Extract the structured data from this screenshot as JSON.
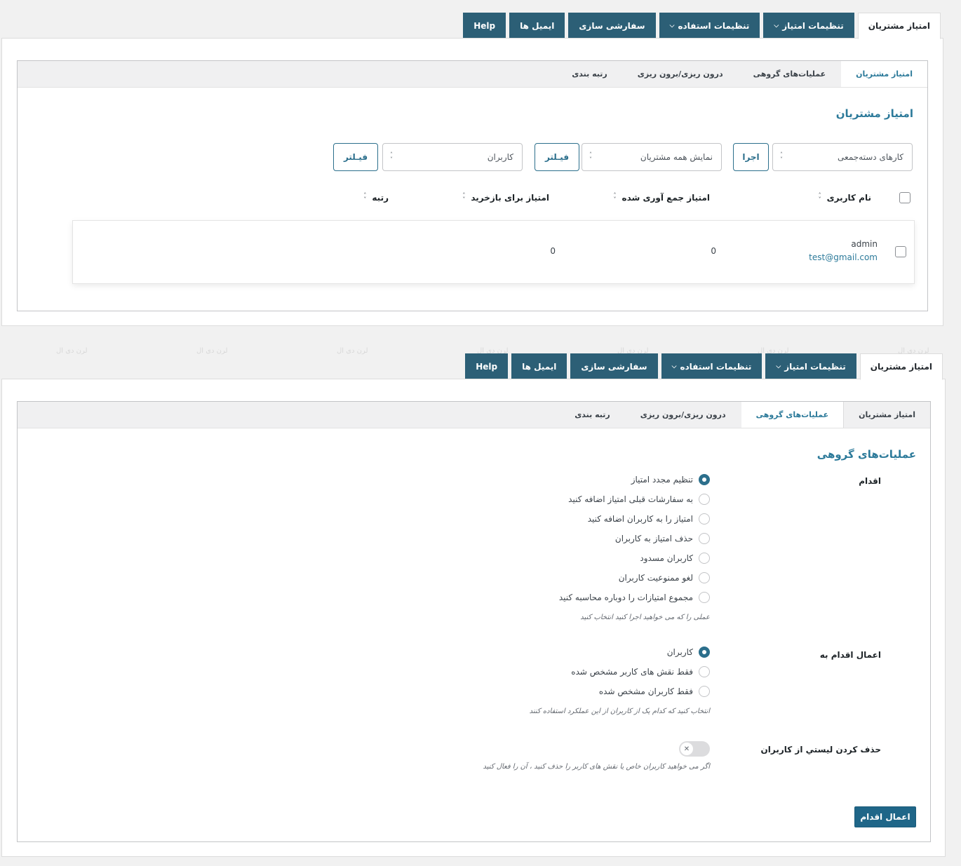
{
  "nav": {
    "tabs": [
      {
        "label": "امتیاز مشتریان",
        "active": true
      },
      {
        "label": "تنظیمات امتیاز",
        "dropdown": true
      },
      {
        "label": "تنظیمات استفاده",
        "dropdown": true
      },
      {
        "label": "سفارشی سازی"
      },
      {
        "label": "ایمیل ها"
      },
      {
        "label": "Help"
      }
    ]
  },
  "subtabs": [
    {
      "label": "امتیاز مشتریان"
    },
    {
      "label": "عملیات‌های گروهی"
    },
    {
      "label": "درون ریزی/برون ریزی"
    },
    {
      "label": "رتبه بندی"
    }
  ],
  "watermark": "لرن دی ال",
  "customers": {
    "title": "امتیاز مشتریان",
    "bulk_select": "کارهای دسته‌جمعی",
    "apply_button": "اجرا",
    "show_select": "نمایش همه مشتریان",
    "filter_button_1": "فیـلتر",
    "users_select": "کاربران",
    "filter_button_2": "فیـلتر",
    "columns": {
      "username": "نام کاربری",
      "collected": "امتیاز جمع آوری شده",
      "redeem": "امتیاز برای بازخرید",
      "rank": "رتبه"
    },
    "rows": [
      {
        "username": "admin",
        "email": "test@gmail.com",
        "collected": "0",
        "redeem": "0",
        "rank": ""
      }
    ]
  },
  "bulk": {
    "title": "عملیات‌های گروهی",
    "action_label": "اقدام",
    "actions": [
      "تنظیم مجدد امتیاز",
      "به سفارشات قبلی امتیاز اضافه کنید",
      "امتیاز را به کاربران اضافه کنید",
      "حذف امتیاز به کاربران",
      "کاربران مسدود",
      "لغو ممنوعیت کاربران",
      "مجموع امتیازات را دوباره محاسبه کنید"
    ],
    "action_selected_index": 0,
    "action_hint": "عملی را که می خواهید اجرا کنید انتخاب کنید",
    "apply_to_label": "اعمال اقدام به",
    "apply_to_options": [
      "کاربران",
      "فقط نقش های کاربر مشخص شده",
      "فقط کاربران مشخص شده"
    ],
    "apply_to_selected_index": 0,
    "apply_to_hint": "انتخاب کنید که کدام یک از کاربران از این عملکرد استفاده کنند",
    "exclude_label": "حذف کردن لیستي از کاربران",
    "exclude_toggle_on": false,
    "exclude_hint": "اگر می خواهید کاربران خاص یا نقش های کاربر را حذف کنید ، آن را فعال کنید",
    "apply_button": "اعمال اقدام"
  },
  "icons": {
    "dropdown": "chevron-down-icon",
    "sort": "sort-arrows-icon",
    "select_arrows": "updown-arrows-icon",
    "toggle_knob": "close-icon"
  }
}
